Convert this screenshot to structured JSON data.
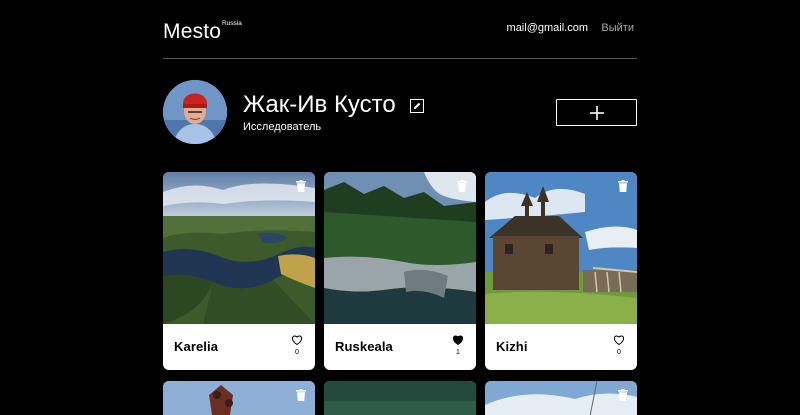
{
  "header": {
    "logo": "Mesto",
    "logo_sup": "Russia",
    "email": "mail@gmail.com",
    "logout_label": "Выйти"
  },
  "profile": {
    "name": "Жак-Ив Кусто",
    "about": "Исследователь"
  },
  "cards": [
    {
      "title": "Karelia",
      "likes": "0",
      "liked": false
    },
    {
      "title": "Ruskeala",
      "likes": "1",
      "liked": true
    },
    {
      "title": "Kizhi",
      "likes": "0",
      "liked": false
    }
  ],
  "colors": {
    "background": "#000000",
    "card": "#ffffff",
    "divider": "#545454",
    "muted": "#a9a9a9"
  },
  "icons": {
    "edit": "pencil-icon",
    "add": "plus-icon",
    "like": "heart-icon",
    "delete": "trash-icon"
  }
}
